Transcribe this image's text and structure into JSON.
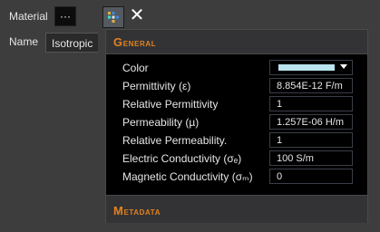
{
  "material": {
    "label": "Material",
    "button_label": "···"
  },
  "name": {
    "label": "Name",
    "value": "Isotropic"
  },
  "toolbar": {
    "edit_icon": "properties-icon",
    "close_glyph": "✕"
  },
  "panel": {
    "general_title": "General",
    "metadata_title": "Metadata",
    "properties": [
      {
        "label": "Color",
        "type": "color",
        "value_color": "#b9e3ee"
      },
      {
        "label": "Permittivity (ε)",
        "value": "8.854E-12 F/m"
      },
      {
        "label": "Relative Permittivity",
        "value": "1"
      },
      {
        "label": "Permeability (µ)",
        "value": "1.257E-06 H/m"
      },
      {
        "label": "Relative Permeability.",
        "value": "1"
      },
      {
        "label": "Electric Conductivity (σₑ)",
        "value": "100 S/m"
      },
      {
        "label": "Magnetic Conductivity (σₘ)",
        "value": "0"
      }
    ]
  },
  "colors": {
    "accent": "#e3821c",
    "background": "#3d3d3d",
    "panel": "#000000"
  }
}
